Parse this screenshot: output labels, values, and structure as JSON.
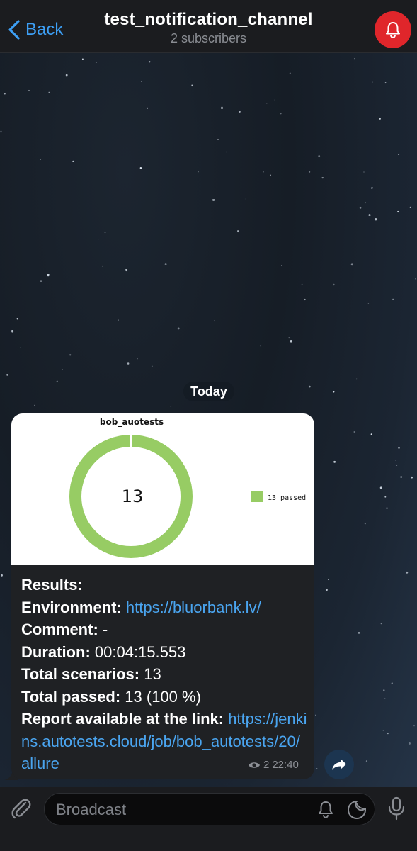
{
  "header": {
    "back_label": "Back",
    "title": "test_notification_channel",
    "subtitle": "2 subscribers"
  },
  "date_separator": "Today",
  "chart_data": {
    "type": "pie",
    "title": "bob_auotests",
    "center_label": "13",
    "slices": [
      {
        "name": "13 passed",
        "value": 13,
        "color": "#97cc64"
      }
    ],
    "legend": [
      "13 passed"
    ],
    "legend_position": "right"
  },
  "message": {
    "lines": [
      {
        "label": "Results:",
        "value": "",
        "link": ""
      },
      {
        "label": "Environment: ",
        "value": "",
        "link": "https://bluorbank.lv/"
      },
      {
        "label": "Comment: ",
        "value": "-",
        "link": ""
      },
      {
        "label": "Duration: ",
        "value": "00:04:15.553",
        "link": ""
      },
      {
        "label": "Total scenarios: ",
        "value": "13",
        "link": ""
      },
      {
        "label": "Total passed: ",
        "value": "13 (100 %)",
        "link": ""
      },
      {
        "label": "Report available at the link: ",
        "value": "",
        "link": "https://jenkins.autotests.cloud/job/bob_autotests/20/allure"
      }
    ],
    "views": "2",
    "time": "22:40"
  },
  "composer": {
    "placeholder": "Broadcast"
  },
  "icons": {
    "back": "chevron-left-icon",
    "mute": "bell-icon",
    "share": "share-arrow-icon",
    "attach": "paperclip-icon",
    "silent": "bell-outline-icon",
    "sticker": "sticker-icon",
    "mic": "microphone-icon",
    "views": "eye-icon"
  },
  "colors": {
    "accent": "#3d9ff5",
    "link": "#4aa5f0",
    "mute_button": "#e0262b",
    "chart_green": "#97cc64"
  }
}
